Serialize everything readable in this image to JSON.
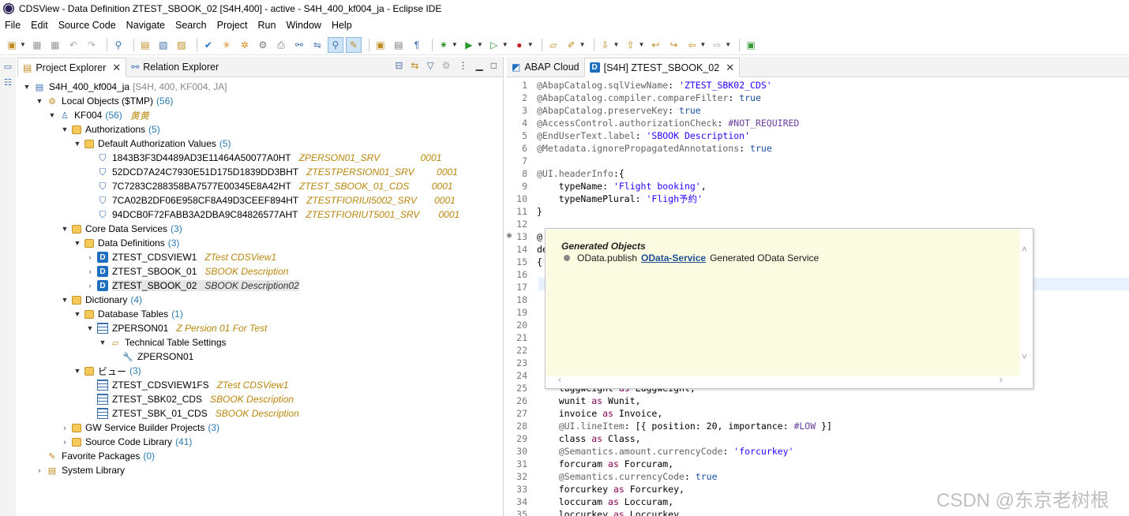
{
  "window": {
    "title": "CDSView - Data Definition ZTEST_SBOOK_02 [S4H,400] - active - S4H_400_kf004_ja - Eclipse IDE"
  },
  "menu": [
    "File",
    "Edit",
    "Source Code",
    "Navigate",
    "Search",
    "Project",
    "Run",
    "Window",
    "Help"
  ],
  "left_tabs": {
    "project_explorer": "Project Explorer",
    "relation_explorer": "Relation Explorer"
  },
  "tree": {
    "root": {
      "name": "S4H_400_kf004_ja",
      "info": "[S4H, 400, KF004, JA]"
    },
    "local_objects": {
      "name": "Local Objects ($TMP)",
      "count": "(56)"
    },
    "kf004": {
      "name": "KF004",
      "count": "(56)",
      "desc": "黄黄"
    },
    "authorizations": {
      "name": "Authorizations",
      "count": "(5)"
    },
    "default_auth": {
      "name": "Default Authorization Values",
      "count": "(5)"
    },
    "auth_items": [
      {
        "name": "1843B3F3D4489AD3E11464A50077A0HT",
        "desc": "ZPERSON01_SRV",
        "num": "0001"
      },
      {
        "name": "52DCD7A24C7930E51D175D1839DD3BHT",
        "desc": "ZTESTPERSION01_SRV",
        "num": "0001"
      },
      {
        "name": "7C7283C288358BA7577E00345E8A42HT",
        "desc": "ZTEST_SBOOK_01_CDS",
        "num": "0001"
      },
      {
        "name": "7CA02B2DF06E958CF8A49D3CEEF894HT",
        "desc": "ZTESTFIORIUI5002_SRV",
        "num": "0001"
      },
      {
        "name": "94DCB0F72FABB3A2DBA9C84826577AHT",
        "desc": "ZTESTFIORIUT5001_SRV",
        "num": "0001"
      }
    ],
    "core_data_services": {
      "name": "Core Data Services",
      "count": "(3)"
    },
    "data_definitions": {
      "name": "Data Definitions",
      "count": "(3)"
    },
    "dd_items": [
      {
        "name": "ZTEST_CDSVIEW1",
        "desc": "ZTest CDSView1"
      },
      {
        "name": "ZTEST_SBOOK_01",
        "desc": "SBOOK Description"
      },
      {
        "name": "ZTEST_SBOOK_02",
        "desc": "SBOOK Description02"
      }
    ],
    "dictionary": {
      "name": "Dictionary",
      "count": "(4)"
    },
    "database_tables": {
      "name": "Database Tables",
      "count": "(1)"
    },
    "zperson01": {
      "name": "ZPERSON01",
      "desc": "Z Persion 01 For Test"
    },
    "tech_settings": {
      "name": "Technical Table Settings"
    },
    "zperson01_leaf": {
      "name": "ZPERSON01"
    },
    "views": {
      "name": "ビュー",
      "count": "(3)"
    },
    "view_items": [
      {
        "name": "ZTEST_CDSVIEW1FS",
        "desc": "ZTest CDSView1"
      },
      {
        "name": "ZTEST_SBK02_CDS",
        "desc": "SBOOK Description"
      },
      {
        "name": "ZTEST_SBK_01_CDS",
        "desc": "SBOOK Description"
      }
    ],
    "gw_service": {
      "name": "GW Service Builder Projects",
      "count": "(3)"
    },
    "source_code_lib": {
      "name": "Source Code Library",
      "count": "(41)"
    },
    "favorite_packages": {
      "name": "Favorite Packages",
      "count": "(0)"
    },
    "system_library": {
      "name": "System Library"
    }
  },
  "editor_tabs": {
    "abap_cloud": "ABAP Cloud",
    "active": "[S4H] ZTEST_SBOOK_02"
  },
  "code_lines": [
    {
      "n": "1",
      "text": "@AbapCatalog.sqlViewName: 'ZTEST_SBK02_CDS'"
    },
    {
      "n": "2",
      "text": "@AbapCatalog.compiler.compareFilter: true"
    },
    {
      "n": "3",
      "text": "@AbapCatalog.preserveKey: true"
    },
    {
      "n": "4",
      "text": "@AccessControl.authorizationCheck: #NOT_REQUIRED"
    },
    {
      "n": "5",
      "text": "@EndUserText.label: 'SBOOK Description'"
    },
    {
      "n": "6",
      "text": "@Metadata.ignorePropagatedAnnotations: true"
    },
    {
      "n": "7",
      "text": ""
    },
    {
      "n": "8",
      "text": "@UI.headerInfo:{"
    },
    {
      "n": "9",
      "text": "    typeName: 'Flight booking',"
    },
    {
      "n": "10",
      "text": "    typeNamePlural: 'Fligh予約'"
    },
    {
      "n": "11",
      "text": "}"
    },
    {
      "n": "12",
      "text": ""
    },
    {
      "n": "13",
      "text": "@"
    },
    {
      "n": "14",
      "text": "de"
    },
    {
      "n": "15",
      "text": "{"
    },
    {
      "n": "16",
      "text": ""
    },
    {
      "n": "17",
      "text": ""
    },
    {
      "n": "18",
      "text": ""
    },
    {
      "n": "19",
      "text": ""
    },
    {
      "n": "20",
      "text": ""
    },
    {
      "n": "21",
      "text": ""
    },
    {
      "n": "22",
      "text": ""
    },
    {
      "n": "23",
      "text": ""
    },
    {
      "n": "24",
      "text": ""
    },
    {
      "n": "25",
      "text": "    luggweight as Luggweight,"
    },
    {
      "n": "26",
      "text": "    wunit as Wunit,"
    },
    {
      "n": "27",
      "text": "    invoice as Invoice,"
    },
    {
      "n": "28",
      "text": "    @UI.lineItem: [{ position: 20, importance: #LOW }]"
    },
    {
      "n": "29",
      "text": "    class as Class,"
    },
    {
      "n": "30",
      "text": "    @Semantics.amount.currencyCode: 'forcurkey'"
    },
    {
      "n": "31",
      "text": "    forcuram as Forcuram,"
    },
    {
      "n": "32",
      "text": "    @Semantics.currencyCode: true"
    },
    {
      "n": "33",
      "text": "    forcurkey as Forcurkey,"
    },
    {
      "n": "34",
      "text": "    loccuram as Loccuram,"
    },
    {
      "n": "35",
      "text": "    loccurkey as Loccurkey,"
    }
  ],
  "popup": {
    "title": "Generated Objects",
    "item_prefix": "OData.publish",
    "item_link": "OData-Service",
    "item_suffix": "Generated OData Service"
  },
  "watermark": "CSDN @东京老树根",
  "colors": {
    "accent": "#1e6fbf",
    "count": "#2a7ab0",
    "desc": "#b8860b",
    "popup_bg": "#fbfbe1",
    "line_highlight": "#e8f2fe"
  }
}
